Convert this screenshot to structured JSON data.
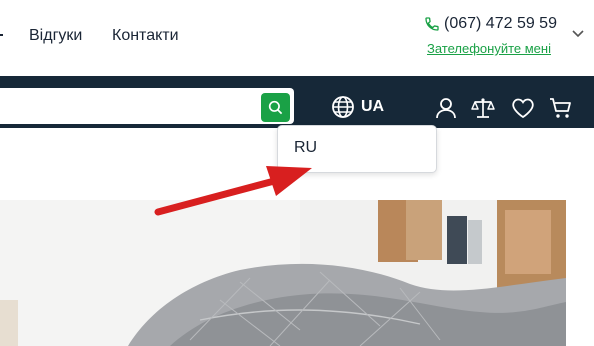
{
  "nav": {
    "reviews": "Відгуки",
    "contacts": "Контакти"
  },
  "contact": {
    "phone": "(067) 472 59 59",
    "callback": "Зателефонуйте мені"
  },
  "search": {
    "value": "",
    "placeholder": ""
  },
  "language": {
    "current": "UA",
    "options": [
      "RU"
    ]
  },
  "icons": {
    "phone": "phone-icon",
    "search": "search-icon",
    "globe": "globe-icon",
    "account": "user-icon",
    "compare": "scales-icon",
    "wishlist": "heart-icon",
    "cart": "cart-icon",
    "chevron": "chevron-down-icon"
  },
  "colors": {
    "navbar": "#162838",
    "accent": "#1aa146",
    "arrow": "#d81f1f"
  }
}
